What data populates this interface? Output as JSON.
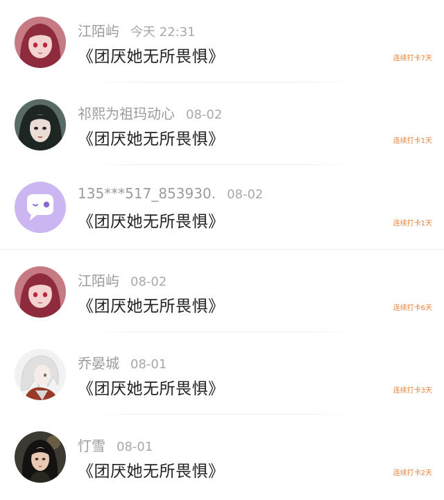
{
  "posts": [
    {
      "author": "江陌屿",
      "time": "今天 22:31",
      "content": "《团厌她无所畏惧》",
      "streak": "连续打卡7天",
      "avatar_icon": "anime-girl-red-hair-avatar-icon",
      "avatar_colors": {
        "bg": "#c67a84",
        "hair": "#8e2b3c",
        "skin": "#f3d2cf"
      }
    },
    {
      "author": "祁熙为祖玛动心",
      "time": "08-02",
      "content": "《团厌她无所畏惧》",
      "streak": "连续打卡1天",
      "avatar_icon": "anime-girl-dark-hair-avatar-icon",
      "avatar_colors": {
        "bg": "#5a6a66",
        "hair": "#1e2623",
        "skin": "#ecdcd6"
      }
    },
    {
      "author": "135***517_853930.",
      "time": "08-02",
      "content": "《团厌她无所畏惧》",
      "streak": "连续打卡1天",
      "avatar_icon": "default-chat-bubble-avatar-icon",
      "avatar_colors": {
        "bg": "#cbb6f1",
        "bubble": "#ffffff",
        "eye": "#8a6ad0"
      }
    },
    {
      "author": "江陌屿",
      "time": "08-02",
      "content": "《团厌她无所畏惧》",
      "streak": "连续打卡6天",
      "avatar_icon": "anime-girl-red-hair-avatar-icon",
      "avatar_colors": {
        "bg": "#c67a84",
        "hair": "#8e2b3c",
        "skin": "#f3d2cf"
      }
    },
    {
      "author": "乔晏城",
      "time": "08-01",
      "content": "《团厌她无所畏惧》",
      "streak": "连续打卡3天",
      "avatar_icon": "anime-boy-white-hair-avatar-icon",
      "avatar_colors": {
        "bg": "#f2f2f2",
        "hair": "#e8e8e8",
        "skin": "#f6ece8",
        "cloth": "#9a3b2a"
      }
    },
    {
      "author": "忊雪",
      "time": "08-01",
      "content": "《团厌她无所畏惧》",
      "streak": "连续打卡2天",
      "avatar_icon": "anime-girl-black-hair-avatar-icon",
      "avatar_colors": {
        "bg": "#3d3a33",
        "hair": "#141210",
        "skin": "#e8c9b4"
      }
    }
  ],
  "theme": {
    "streak_color": "#e8813a",
    "name_color": "#9b9b9b",
    "content_color": "#222222"
  }
}
